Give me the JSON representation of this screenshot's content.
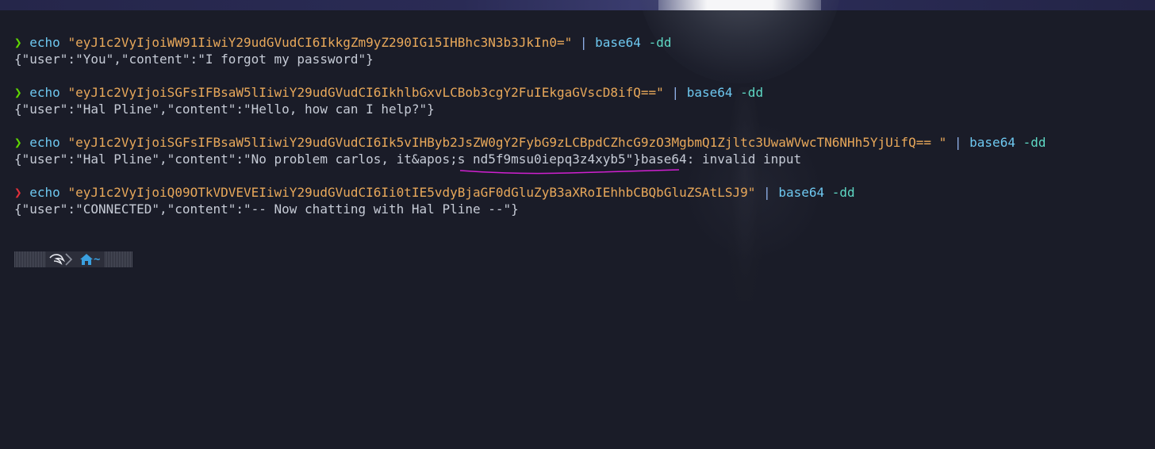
{
  "terminal": {
    "commands": [
      {
        "status": "success",
        "prompt": "❯",
        "cmd": "echo",
        "arg": "\"eyJ1c2VyIjoiWW91IiwiY29udGVudCI6IkkgZm9yZ290IG15IHBhc3N3b3JkIn0=\"",
        "pipe": "|",
        "tool": "base64",
        "flag": "-dd",
        "output": "{\"user\":\"You\",\"content\":\"I forgot my password\"}"
      },
      {
        "status": "success",
        "prompt": "❯",
        "cmd": "echo",
        "arg": "\"eyJ1c2VyIjoiSGFsIFBsaW5lIiwiY29udGVudCI6IkhlbGxvLCBob3cgY2FuIEkgaGVscD8ifQ==\"",
        "pipe": "|",
        "tool": "base64",
        "flag": "-dd",
        "output": "{\"user\":\"Hal Pline\",\"content\":\"Hello, how can I help?\"}"
      },
      {
        "status": "success",
        "prompt": "❯",
        "cmd": "echo",
        "arg": "\"eyJ1c2VyIjoiSGFsIFBsaW5lIiwiY29udGVudCI6Ik5vIHByb2JsZW0gY2FybG9zLCBpdCZhcG9zO3MgbmQ1Zjltc3UwaWVwcTN6NHh5YjUifQ== \"",
        "pipe": "|",
        "tool": "base64",
        "flag": "-dd",
        "output_prefix": "{\"user\":\"Hal Pline\",\"content\":\"No problem carlos, it&apos;s ",
        "output_highlight": "nd5f9msu0iepq3z4xyb5",
        "output_suffix": "\"}base64: invalid input"
      },
      {
        "status": "error",
        "prompt": "❯",
        "cmd": "echo",
        "arg": "\"eyJ1c2VyIjoiQ09OTkVDVEVEIiwiY29udGVudCI6Ii0tIE5vdyBjaGF0dGluZyB3aXRoIEhhbCBQbGluZSAtLSJ9\"",
        "pipe": "|",
        "tool": "base64",
        "flag": "-dd",
        "output": "{\"user\":\"CONNECTED\",\"content\":\"-- Now chatting with Hal Pline --\"}"
      }
    ]
  },
  "prompt_bar": {
    "os_icon": "kali-dragon-icon",
    "home_icon": "home-icon",
    "cwd": "~"
  },
  "colors": {
    "background": "#1a1c28",
    "prompt_success": "#5fd700",
    "prompt_error": "#e0303a",
    "string": "#e8a85a",
    "command": "#6ec8f0",
    "flag": "#5ed8c4",
    "output": "#c6cbd6",
    "annotation": "#d020d0"
  }
}
